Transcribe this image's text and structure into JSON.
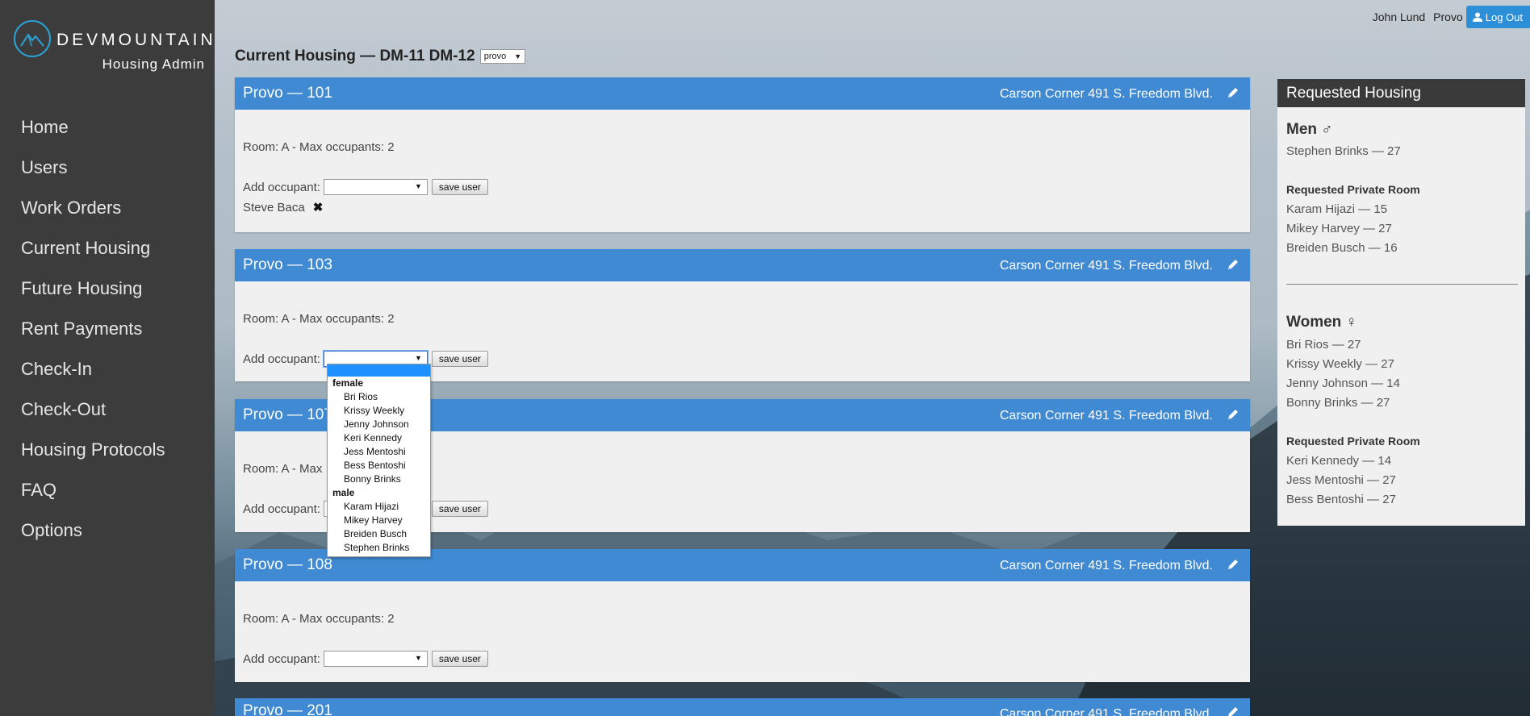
{
  "sidebar": {
    "brand": "DEVMOUNTAIN",
    "subtitle": "Housing Admin",
    "logo_icon": "mountain-logo-icon",
    "items": [
      {
        "label": "Home"
      },
      {
        "label": "Users"
      },
      {
        "label": "Work Orders"
      },
      {
        "label": "Current Housing"
      },
      {
        "label": "Future Housing"
      },
      {
        "label": "Rent Payments"
      },
      {
        "label": "Check-In"
      },
      {
        "label": "Check-Out"
      },
      {
        "label": "Housing Protocols"
      },
      {
        "label": "FAQ"
      },
      {
        "label": "Options"
      }
    ]
  },
  "topbar": {
    "user_name": "John Lund",
    "location": "Provo",
    "logout_label": "Log Out"
  },
  "heading": {
    "title": "Current Housing — DM-11 DM-12",
    "location_select": "provo"
  },
  "rooms": [
    {
      "title": "Provo — 101",
      "address": "Carson Corner 491 S. Freedom Blvd.",
      "room_info": "Room: A - Max occupants: 2",
      "add_label": "Add occupant:",
      "save_label": "save user",
      "occupant": "Steve Baca",
      "remove_glyph": "✖"
    },
    {
      "title": "Provo — 103",
      "address": "Carson Corner 491 S. Freedom Blvd.",
      "room_info": "Room: A - Max occupants: 2",
      "add_label": "Add occupant:",
      "save_label": "save user"
    },
    {
      "title": "Provo — 107",
      "address": "Carson Corner 491 S. Freedom Blvd.",
      "room_info": "Room: A - Max",
      "add_label": "Add occupant:",
      "save_label": "save user"
    },
    {
      "title": "Provo — 108",
      "address": "Carson Corner 491 S. Freedom Blvd.",
      "room_info": "Room: A - Max occupants: 2",
      "add_label": "Add occupant:",
      "save_label": "save user"
    },
    {
      "title": "Provo — 201",
      "address": "Carson Corner 491 S. Freedom Blvd."
    }
  ],
  "dropdown": {
    "female_label": "female",
    "female": [
      "Bri Rios",
      "Krissy Weekly",
      "Jenny Johnson",
      "Keri Kennedy",
      "Jess Mentoshi",
      "Bess Bentoshi",
      "Bonny Brinks"
    ],
    "male_label": "male",
    "male": [
      "Karam Hijazi",
      "Mikey Harvey",
      "Breiden Busch",
      "Stephen Brinks"
    ]
  },
  "requested": {
    "title": "Requested Housing",
    "men_title": "Men ♂",
    "men": [
      "Stephen Brinks — 27"
    ],
    "men_private_title": "Requested Private Room",
    "men_private": [
      "Karam Hijazi — 15",
      "Mikey Harvey — 27",
      "Breiden Busch — 16"
    ],
    "women_title": "Women ♀",
    "women": [
      "Bri Rios — 27",
      "Krissy Weekly — 27",
      "Jenny Johnson — 14",
      "Bonny Brinks — 27"
    ],
    "women_private_title": "Requested Private Room",
    "women_private": [
      "Keri Kennedy — 14",
      "Jess Mentoshi — 27",
      "Bess Bentoshi — 27"
    ]
  },
  "colors": {
    "sidebar_bg": "#3c3c3c",
    "panel_header": "#3f8ad2",
    "accent": "#2aa3d8",
    "logout_bg": "#2d8fd8"
  }
}
